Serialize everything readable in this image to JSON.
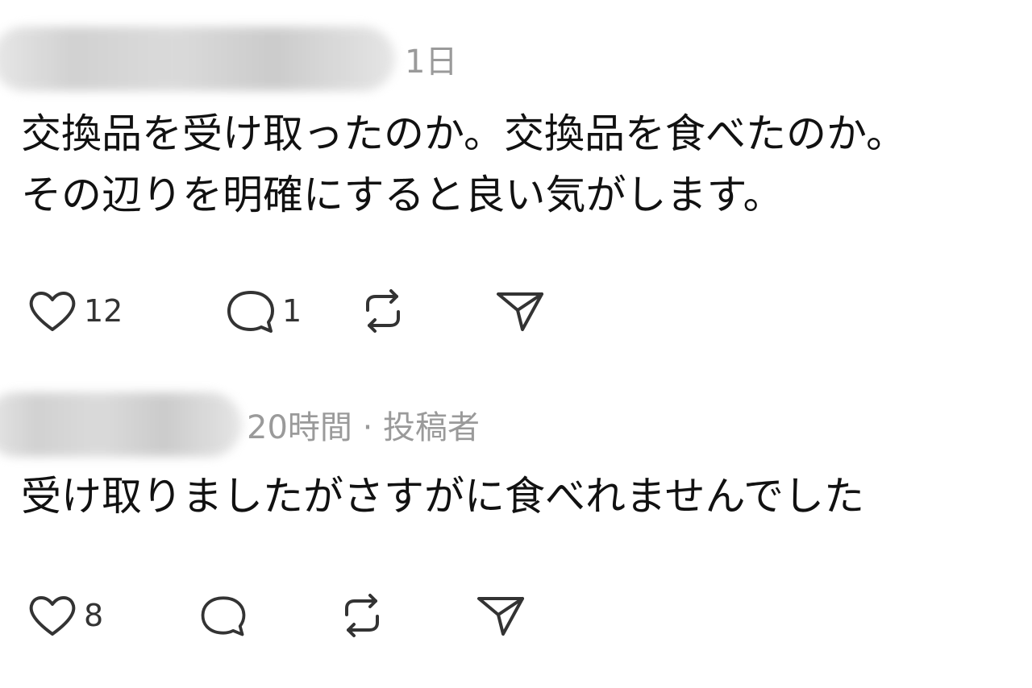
{
  "comments": [
    {
      "time": "1日",
      "author_tag": "",
      "text": "交換品を受け取ったのか。交換品を食べたのか。\nその辺りを明確にすると良い気がします。",
      "likes": "12",
      "replies": "1"
    },
    {
      "time": "20時間 · 投稿者",
      "author_tag": "",
      "text": "受け取りましたがさすがに食べれませんでした",
      "likes": "8",
      "replies": ""
    }
  ],
  "icons": {
    "like": "heart-icon",
    "reply": "comment-bubble-icon",
    "repost": "repost-icon",
    "share": "send-icon"
  },
  "colors": {
    "text": "#111111",
    "muted": "#9a9a9a",
    "icon": "#333333"
  }
}
